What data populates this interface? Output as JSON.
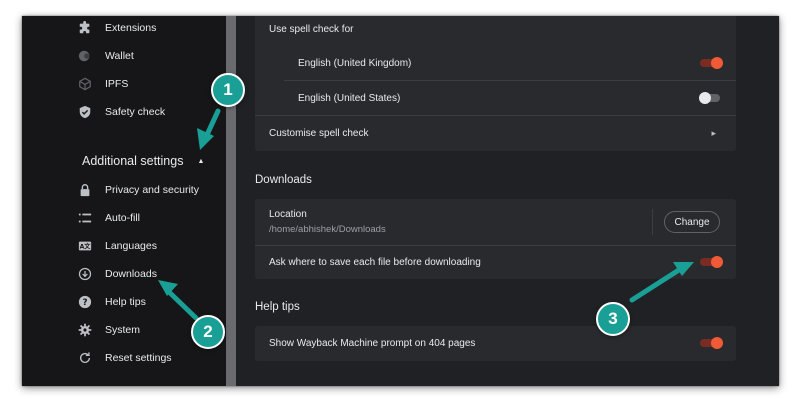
{
  "sidebar": {
    "items_top": [
      {
        "label": "Extensions",
        "icon": "puzzle-icon"
      },
      {
        "label": "Wallet",
        "icon": "wallet-icon"
      },
      {
        "label": "IPFS",
        "icon": "ipfs-cube-icon"
      },
      {
        "label": "Safety check",
        "icon": "shield-check-icon"
      }
    ],
    "additional_heading": "Additional settings",
    "items_bottom": [
      {
        "label": "Privacy and security",
        "icon": "lock-icon"
      },
      {
        "label": "Auto-fill",
        "icon": "list-icon"
      },
      {
        "label": "Languages",
        "icon": "translate-icon"
      },
      {
        "label": "Downloads",
        "icon": "download-circle-icon"
      },
      {
        "label": "Help tips",
        "icon": "help-circle-icon"
      },
      {
        "label": "System",
        "icon": "gear-icon"
      },
      {
        "label": "Reset settings",
        "icon": "reset-icon"
      }
    ]
  },
  "spellcheck": {
    "use_label": "Use spell check for",
    "languages": [
      {
        "label": "English (United Kingdom)",
        "enabled": true
      },
      {
        "label": "English (United States)",
        "enabled": false
      }
    ],
    "customise_label": "Customise spell check"
  },
  "downloads": {
    "title": "Downloads",
    "location_label": "Location",
    "location_path": "/home/abhishek/Downloads",
    "change_label": "Change",
    "ask_label": "Ask where to save each file before downloading",
    "ask_enabled": true
  },
  "help_tips": {
    "title": "Help tips",
    "wayback_label": "Show Wayback Machine prompt on 404 pages",
    "wayback_enabled": true
  },
  "annotations": {
    "badges": [
      "1",
      "2",
      "3"
    ],
    "color": "#1a9f96"
  },
  "colors": {
    "accent": "#f05a36",
    "background": "#202124",
    "card": "#292a2d",
    "sidebar": "#161618"
  }
}
